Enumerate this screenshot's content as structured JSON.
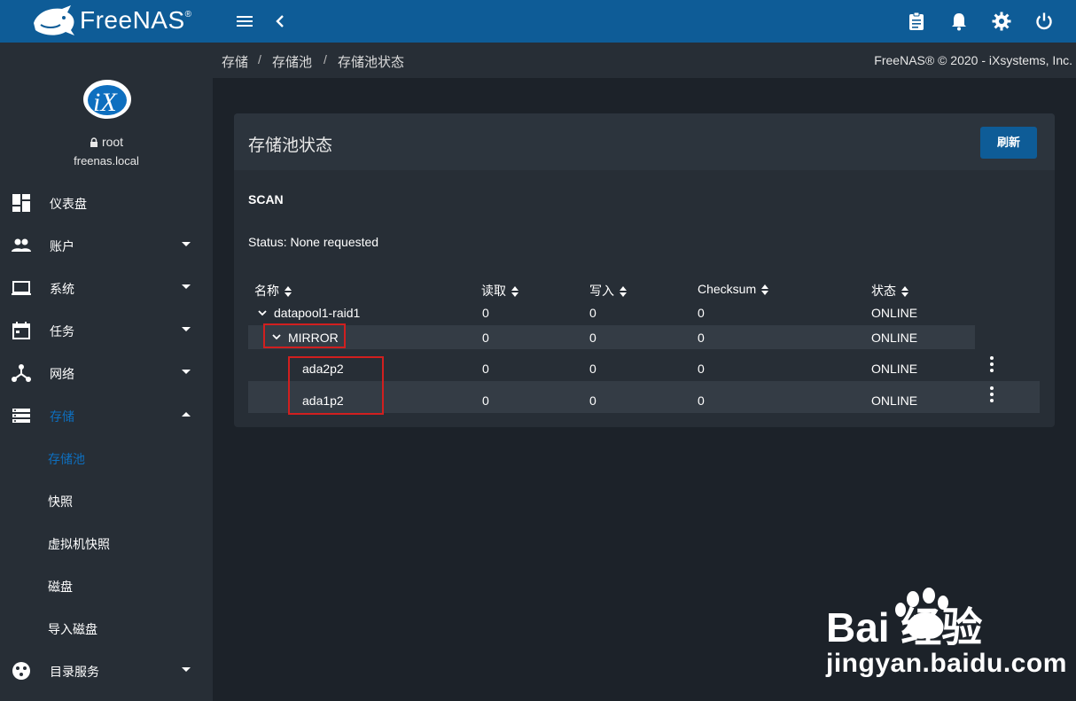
{
  "app": {
    "brand": "FreeNAS",
    "brand_mark": "®"
  },
  "colors": {
    "topbar": "#0e5c97",
    "sidebar": "#272e36",
    "content_bg": "#1c2229",
    "card": "#272e36",
    "accent": "#0e6fbf",
    "highlight": "#d11f1f"
  },
  "topbar": {
    "icons": [
      "menu-icon",
      "back-icon",
      "clipboard-icon",
      "bell-icon",
      "gear-icon",
      "power-icon"
    ]
  },
  "user": {
    "name": "root",
    "host": "freenas.local"
  },
  "sidebar": {
    "items": [
      {
        "label": "仪表盘",
        "icon": "dashboard-icon"
      },
      {
        "label": "账户",
        "icon": "people-icon"
      },
      {
        "label": "系统",
        "icon": "laptop-icon"
      },
      {
        "label": "任务",
        "icon": "calendar-icon"
      },
      {
        "label": "网络",
        "icon": "network-icon"
      },
      {
        "label": "存储",
        "icon": "storage-icon"
      }
    ],
    "storage_sub": [
      "存储池",
      "快照",
      "虚拟机快照",
      "磁盘",
      "导入磁盘"
    ],
    "directory_services": {
      "label": "目录服务",
      "icon": "directory-icon"
    }
  },
  "breadcrumb": [
    "存储",
    "存储池",
    "存储池状态"
  ],
  "copyright": "FreeNAS® © 2020 - iXsystems, Inc.",
  "card": {
    "title": "存储池状态",
    "refresh_label": "刷新",
    "scan_label": "SCAN",
    "status": "Status: None requested"
  },
  "table": {
    "columns": [
      "名称",
      "读取",
      "写入",
      "Checksum",
      "状态"
    ],
    "rows": [
      {
        "name": "datapool1-raid1",
        "read": "0",
        "write": "0",
        "checksum": "0",
        "state": "ONLINE"
      },
      {
        "name": "MIRROR",
        "read": "0",
        "write": "0",
        "checksum": "0",
        "state": "ONLINE"
      },
      {
        "name": "ada2p2",
        "read": "0",
        "write": "0",
        "checksum": "0",
        "state": "ONLINE"
      },
      {
        "name": "ada1p2",
        "read": "0",
        "write": "0",
        "checksum": "0",
        "state": "ONLINE"
      }
    ]
  },
  "watermark": {
    "brand": "Bai 经验",
    "url": "jingyan.baidu.com"
  }
}
